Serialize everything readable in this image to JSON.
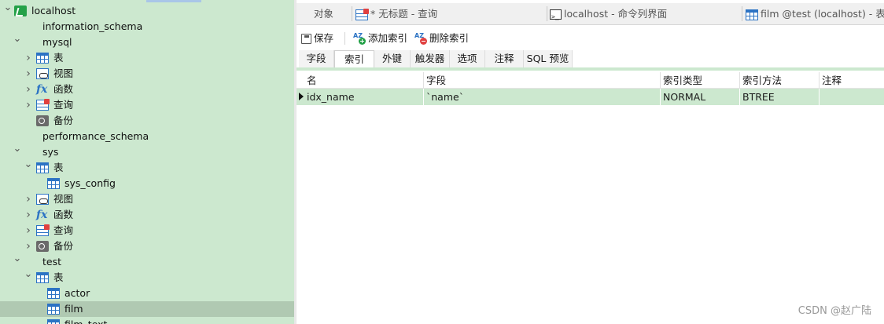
{
  "tree": [
    {
      "label": "localhost",
      "icon": "server-icon",
      "chevron": "expanded",
      "level": 0
    },
    {
      "label": "information_schema",
      "icon": "database-gray-icon",
      "chevron": "none",
      "level": 1
    },
    {
      "label": "mysql",
      "icon": "database-green-icon",
      "chevron": "expanded",
      "level": 1
    },
    {
      "label": "表",
      "icon": "table-icon",
      "chevron": "collapsed",
      "level": 2
    },
    {
      "label": "视图",
      "icon": "view-icon",
      "chevron": "collapsed",
      "level": 2
    },
    {
      "label": "函数",
      "icon": "function-icon",
      "chevron": "collapsed",
      "level": 2
    },
    {
      "label": "查询",
      "icon": "query-icon",
      "chevron": "collapsed",
      "level": 2
    },
    {
      "label": "备份",
      "icon": "backup-icon",
      "chevron": "none",
      "level": 2
    },
    {
      "label": "performance_schema",
      "icon": "database-gray-icon",
      "chevron": "none",
      "level": 1
    },
    {
      "label": "sys",
      "icon": "database-green-icon",
      "chevron": "expanded",
      "level": 1
    },
    {
      "label": "表",
      "icon": "table-icon",
      "chevron": "expanded",
      "level": 2
    },
    {
      "label": "sys_config",
      "icon": "table-icon",
      "chevron": "none",
      "level": 3
    },
    {
      "label": "视图",
      "icon": "view-icon",
      "chevron": "collapsed",
      "level": 2
    },
    {
      "label": "函数",
      "icon": "function-icon",
      "chevron": "collapsed",
      "level": 2
    },
    {
      "label": "查询",
      "icon": "query-icon",
      "chevron": "collapsed",
      "level": 2
    },
    {
      "label": "备份",
      "icon": "backup-icon",
      "chevron": "collapsed",
      "level": 2
    },
    {
      "label": "test",
      "icon": "database-green-icon",
      "chevron": "expanded",
      "level": 1
    },
    {
      "label": "表",
      "icon": "table-icon",
      "chevron": "expanded",
      "level": 2
    },
    {
      "label": "actor",
      "icon": "table-icon",
      "chevron": "none",
      "level": 3
    },
    {
      "label": "film",
      "icon": "table-icon",
      "chevron": "none",
      "level": 3,
      "selected": true
    },
    {
      "label": "film_text",
      "icon": "table-icon",
      "chevron": "none",
      "level": 3
    }
  ],
  "doc_tabs": [
    {
      "label": "对象",
      "icon": ""
    },
    {
      "label": "* 无标题 - 查询",
      "icon": "query-icon"
    },
    {
      "label": "localhost - 命令列界面",
      "icon": "terminal-icon"
    },
    {
      "label": "film @test (localhost) - 表",
      "icon": "table-icon"
    }
  ],
  "toolbar": {
    "save_label": "保存",
    "add_index_label": "添加索引",
    "delete_index_label": "删除索引"
  },
  "subtabs": [
    {
      "label": "字段",
      "active": false
    },
    {
      "label": "索引",
      "active": true
    },
    {
      "label": "外键",
      "active": false
    },
    {
      "label": "触发器",
      "active": false
    },
    {
      "label": "选项",
      "active": false
    },
    {
      "label": "注释",
      "active": false
    },
    {
      "label": "SQL 预览",
      "active": false
    }
  ],
  "index_grid": {
    "columns": [
      "名",
      "字段",
      "索引类型",
      "索引方法",
      "注释"
    ],
    "rows": [
      [
        "idx_name",
        "`name`",
        "NORMAL",
        "BTREE",
        ""
      ]
    ]
  },
  "watermark": "CSDN @赵广陆",
  "colors": {
    "sidebar_bg": "#cce8cf",
    "selected_row": "#b0c9b2",
    "accent_blue": "#2c73c4",
    "db_green": "#24a148"
  }
}
